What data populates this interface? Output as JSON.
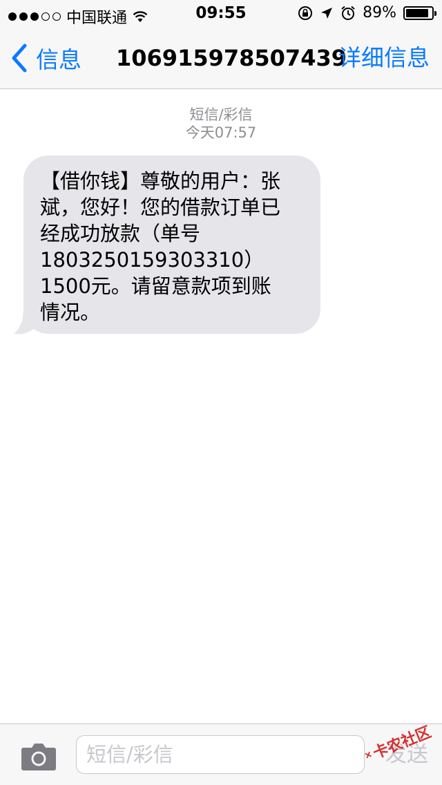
{
  "status_bar": {
    "carrier": "中国联通",
    "time": "09:55",
    "battery_percent": "89%",
    "battery_level": 0.89,
    "signal_dots_filled": 3,
    "signal_dots_total": 5,
    "icons": [
      "wifi-icon",
      "rotation-lock-icon",
      "location-arrow-icon",
      "alarm-icon",
      "battery-icon"
    ]
  },
  "nav": {
    "back_label": "信息",
    "title": "106915978507439",
    "details_label": "详细信息"
  },
  "conversation": {
    "service_label": "短信/彩信",
    "timestamp": "今天07:57",
    "message_lines": [
      "【借你钱】尊敬的用户：张",
      "斌，您好！您的借款订单已",
      "经成功放款（单号",
      "1803250159303310）",
      "1500元。请留意款项到账",
      "情况。"
    ]
  },
  "input_bar": {
    "placeholder": "短信/彩信",
    "value": "",
    "send_label": "发送"
  },
  "watermark": {
    "text": "卡农社区"
  },
  "colors": {
    "accent": "#0a7aff",
    "bubble_gray": "#e5e5ea",
    "bar_bg": "#f7f7f8",
    "meta_text": "#8e8e93",
    "watermark_red": "#d42020"
  }
}
